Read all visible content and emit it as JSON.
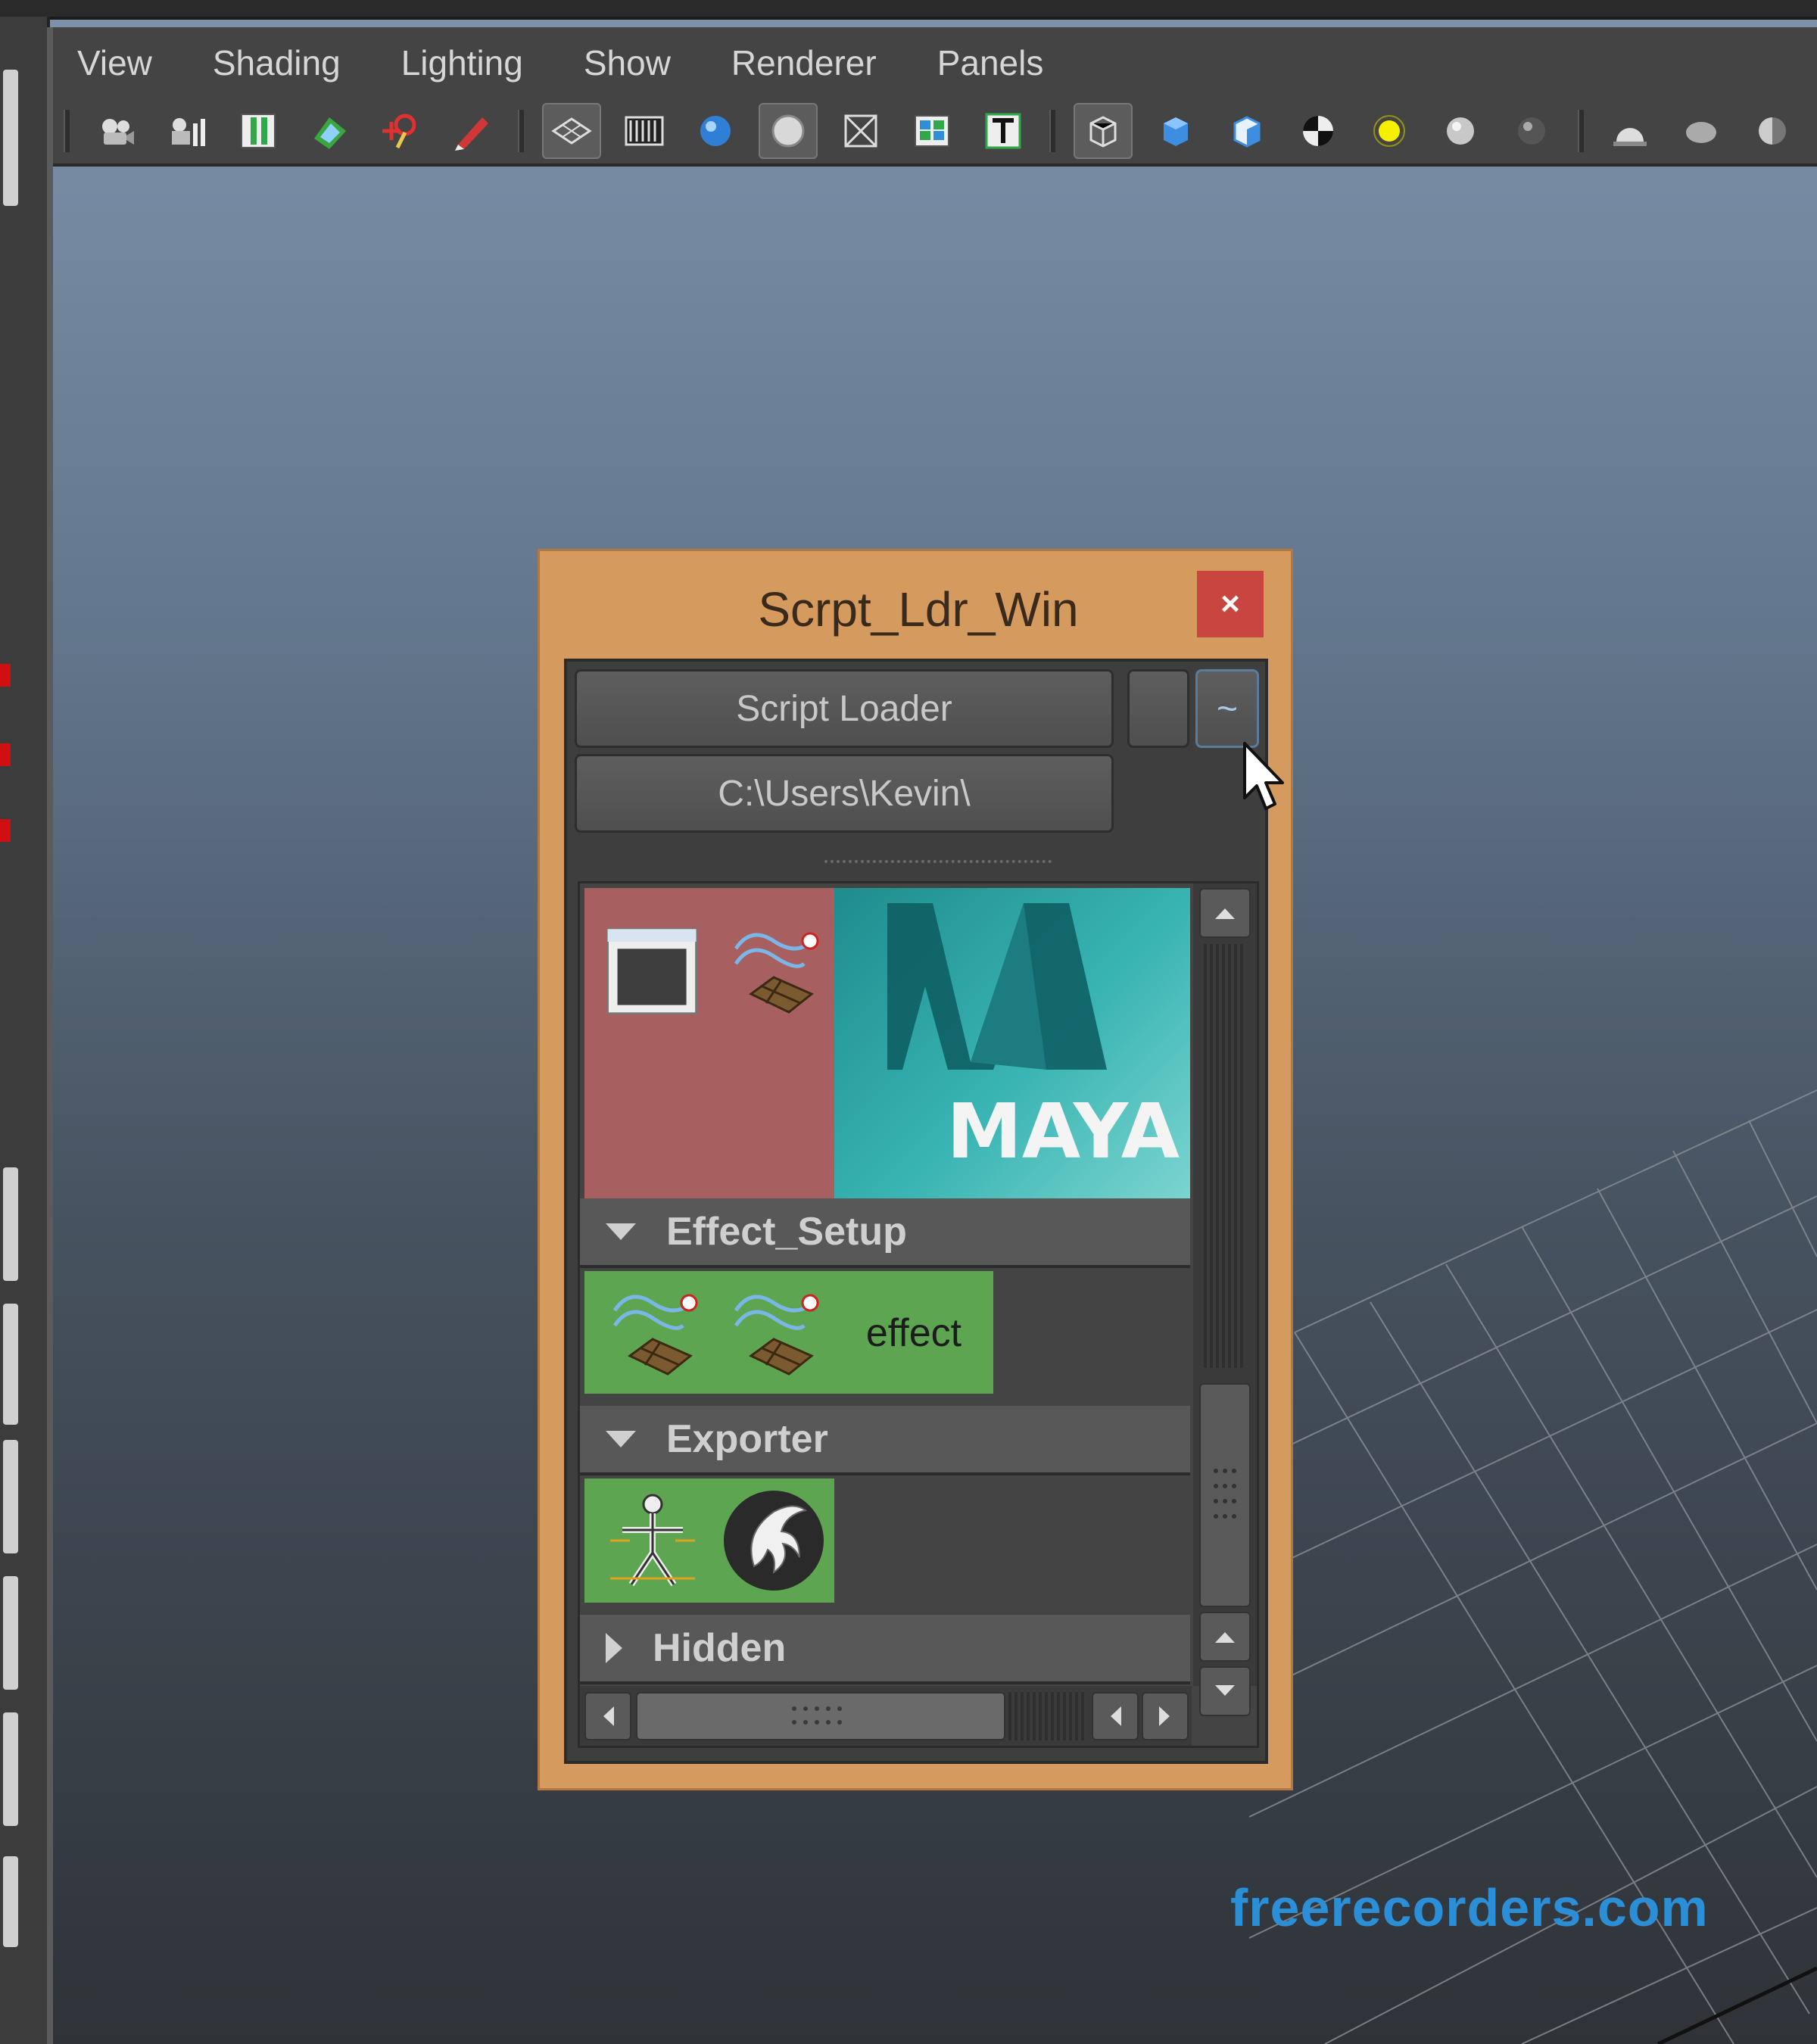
{
  "menubar": {
    "items": [
      "View",
      "Shading",
      "Lighting",
      "Show",
      "Renderer",
      "Panels"
    ]
  },
  "toolbar": {
    "groups": [
      [
        "camera-icon",
        "camera-attributes-icon",
        "bookmark-icon",
        "image-plane-icon",
        "2d-pan-zoom-icon",
        "grease-pencil-icon"
      ],
      [
        "wireframe-icon",
        "film-gate-icon",
        "smooth-shade-icon",
        "wireframe-on-shaded-icon",
        "xray-icon",
        "textured-icon",
        "text-t-icon"
      ],
      [
        "isolate-select-icon",
        "default-material-icon",
        "shaded-cube-icon",
        "checker-icon",
        "yellow-light-icon",
        "grey-sphere-icon",
        "dark-sphere-icon"
      ],
      [
        "shadow-dome-icon",
        "ambient-occlusion-icon",
        "half-sphere-icon"
      ]
    ]
  },
  "window": {
    "title": "Scrpt_Ldr_Win",
    "close_label": "×",
    "script_loader_label": "Script Loader",
    "path_label": "C:\\Users\\Kevin\\",
    "tilde_label": "~",
    "banner_text": "MAYA",
    "frames": [
      {
        "label": "Effect_Setup",
        "expanded": true,
        "tiles": [
          "effect-script-icon",
          "effect-script-icon",
          "effect"
        ]
      },
      {
        "label": "Exporter",
        "expanded": true,
        "tiles": [
          "skeleton-icon",
          "maya-logo-icon"
        ]
      },
      {
        "label": "Hidden",
        "expanded": false
      }
    ]
  },
  "watermark": "freerecorders.com",
  "colors": {
    "window_border": "#d59a5e",
    "close_button": "#c8463f",
    "tile_green": "#5ea552",
    "tile_red": "#a85f5f",
    "watermark": "#2b8fd8"
  }
}
